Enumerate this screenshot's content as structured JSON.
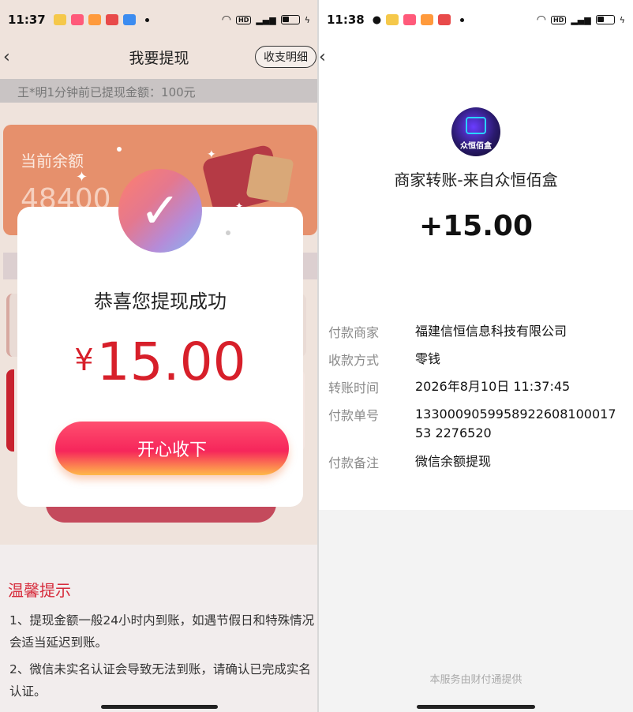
{
  "left": {
    "status_bar": {
      "time": "11:37"
    },
    "header": {
      "title": "我要提现",
      "detail_button": "收支明细"
    },
    "ticker": "王*明1分钟前已提现金额：100元",
    "balance": {
      "label": "当前余额",
      "value": "48400"
    },
    "tips": {
      "title": "温馨提示",
      "items": [
        "1、提现金额一般24小时内到账，如遇节假日和特殊情况会适当延迟到账。",
        "2、微信未实名认证会导致无法到账，请确认已完成实名认证。"
      ]
    },
    "modal": {
      "title": "恭喜您提现成功",
      "currency": "¥",
      "amount": "15.00",
      "button": "开心收下"
    }
  },
  "right": {
    "status_bar": {
      "time": "11:38"
    },
    "logo_text": "众恒佰盒",
    "title": "商家转账-来自众恒佰盒",
    "amount": "+15.00",
    "details": [
      {
        "label": "付款商家",
        "value": "福建信恒信息科技有限公司"
      },
      {
        "label": "收款方式",
        "value": "零钱"
      },
      {
        "label": "转账时间",
        "value": "2026年8月10日 11:37:45"
      },
      {
        "label": "付款单号",
        "value": "133000905995892260810001753 2276520"
      },
      {
        "label": "付款备注",
        "value": "微信余额提现"
      }
    ],
    "footer": "本服务由财付通提供"
  }
}
